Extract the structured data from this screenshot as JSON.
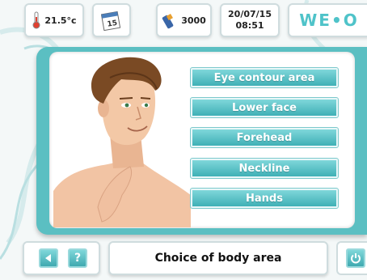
{
  "status": {
    "temperature": "21.5°c",
    "calendar_day": "15",
    "counter": "3000",
    "date": "20/07/15",
    "time": "08:51",
    "logo": "WE•O"
  },
  "body_areas": [
    {
      "label": "Eye contour area"
    },
    {
      "label": "Lower face"
    },
    {
      "label": "Forehead"
    },
    {
      "label": "Neckline"
    },
    {
      "label": "Hands"
    }
  ],
  "footer": {
    "back_icon": "back-icon",
    "help_label": "?",
    "title": "Choice of body area",
    "power_icon": "power-icon"
  },
  "colors": {
    "accent": "#5bbfc2",
    "button_top": "#7fd7da",
    "button_bottom": "#3fb0b6",
    "background": "#f4f8f8"
  }
}
